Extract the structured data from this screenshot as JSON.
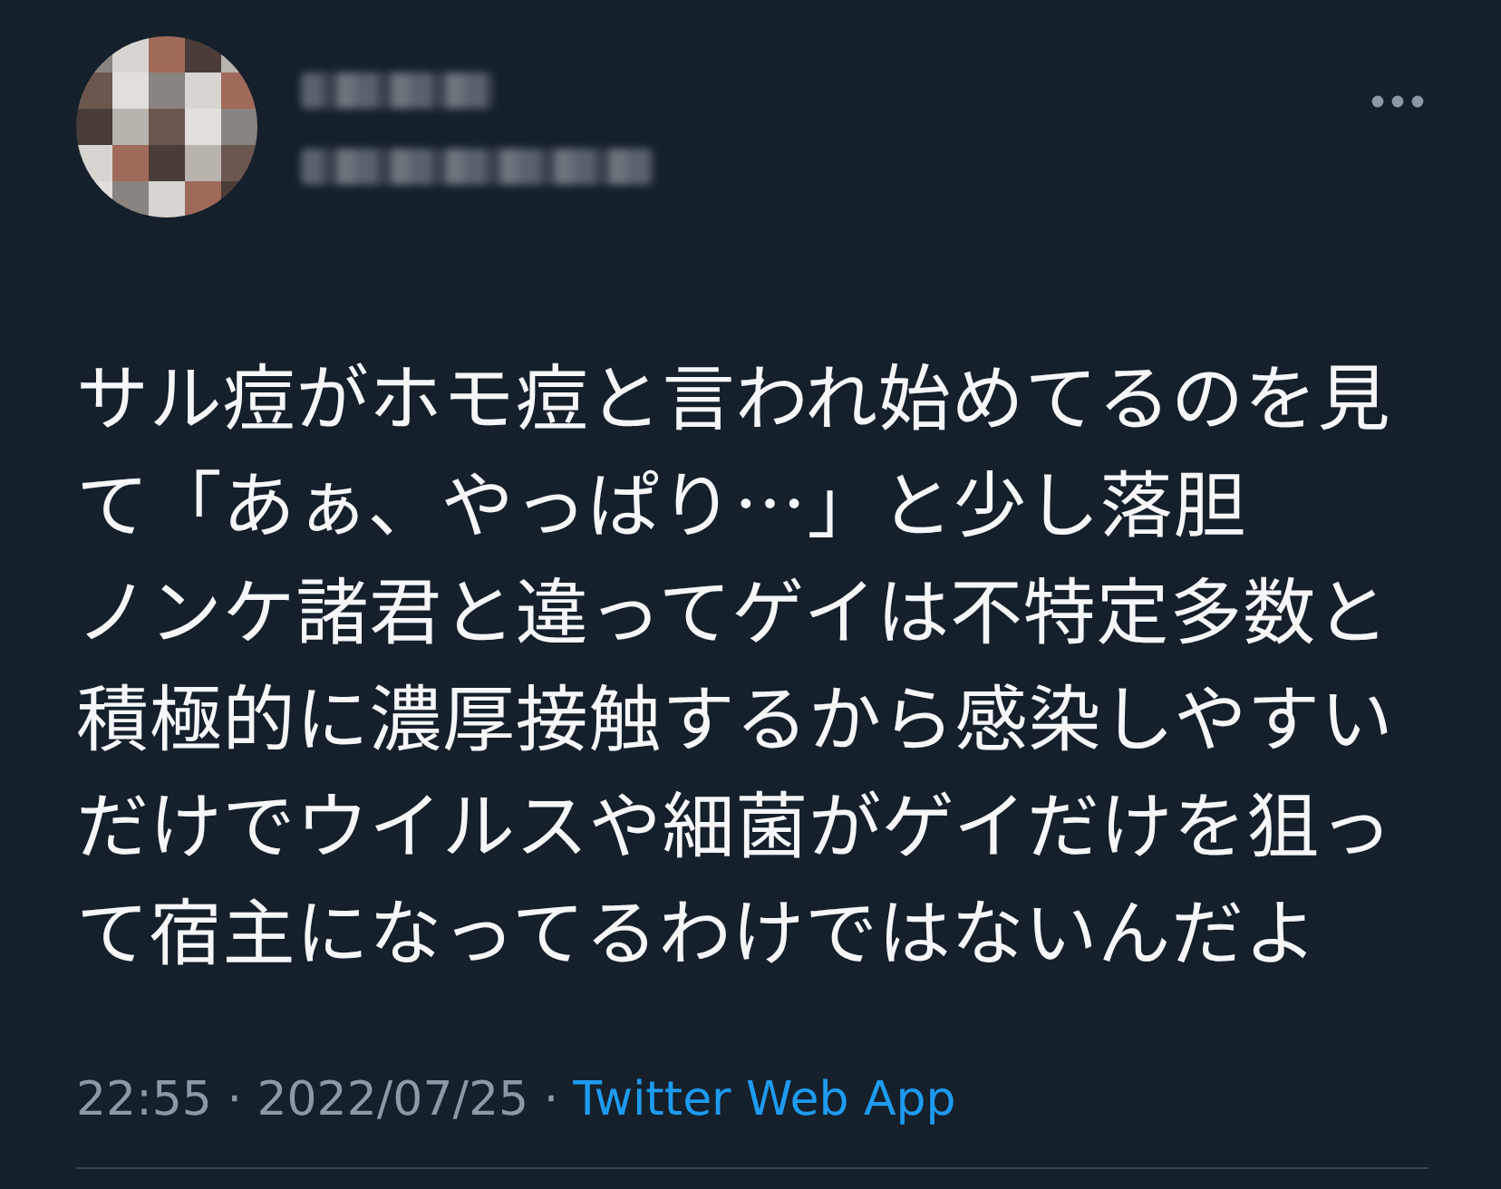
{
  "tweet": {
    "paragraphs": [
      "サル痘がホモ痘と言われ始めてるのを見て「あぁ、やっぱり…」と少し落胆",
      "ノンケ諸君と違ってゲイは不特定多数と積極的に濃厚接触するから感染しやすいだけでウイルスや細菌がゲイだけを狙って宿主になってるわけではないんだよ"
    ],
    "timestamp": "22:55 · 2022/07/25 ·",
    "source": "Twitter Web App"
  }
}
